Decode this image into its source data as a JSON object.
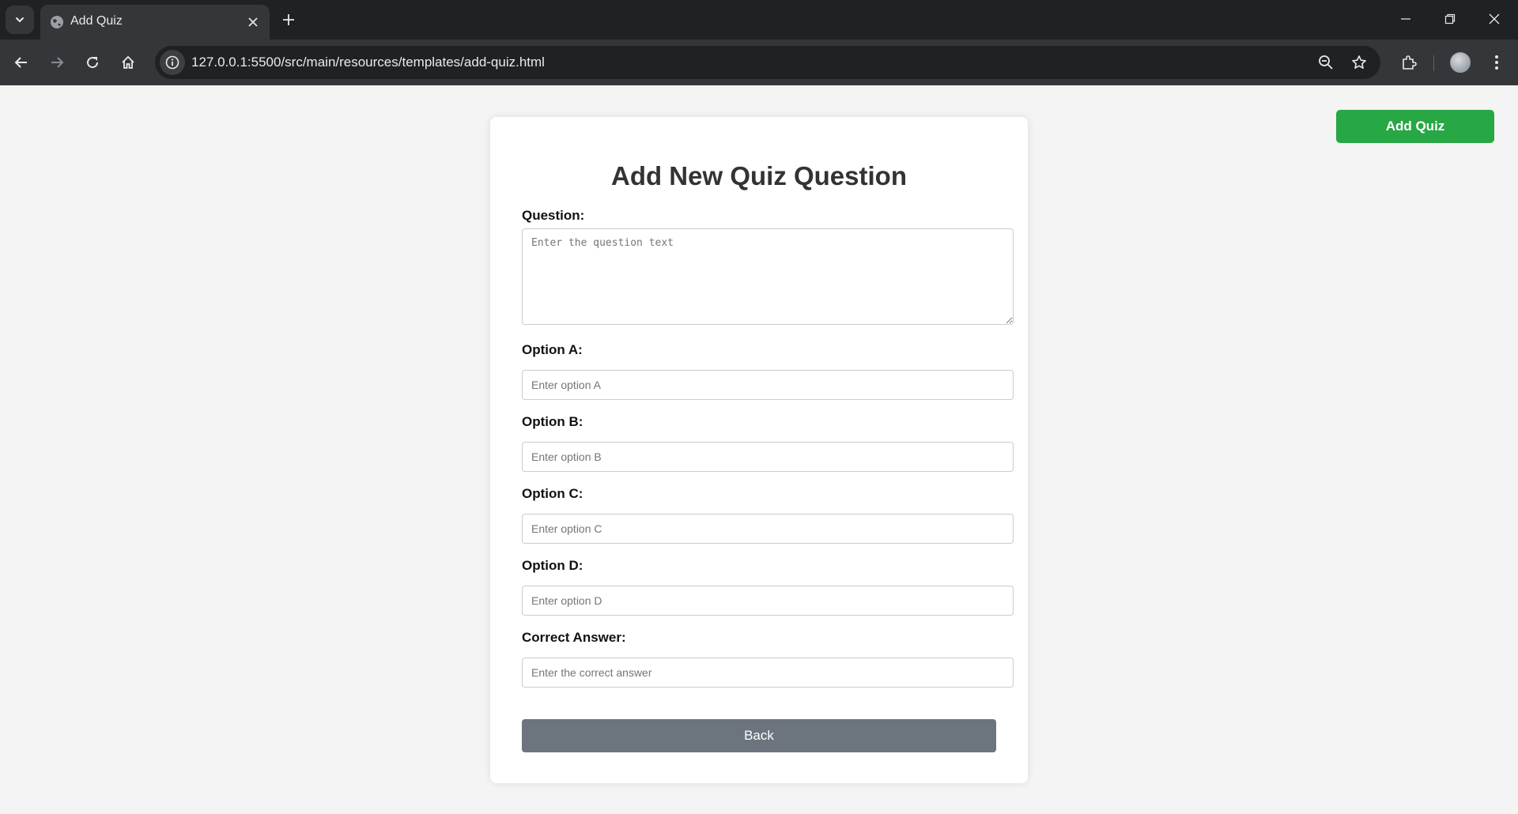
{
  "browser": {
    "tab_title": "Add Quiz",
    "url": "127.0.0.1:5500/src/main/resources/templates/add-quiz.html"
  },
  "header": {
    "add_quiz_label": "Add Quiz"
  },
  "form": {
    "title": "Add New Quiz Question",
    "question": {
      "label": "Question:",
      "placeholder": "Enter the question text",
      "value": ""
    },
    "option_a": {
      "label": "Option A:",
      "placeholder": "Enter option A",
      "value": ""
    },
    "option_b": {
      "label": "Option B:",
      "placeholder": "Enter option B",
      "value": ""
    },
    "option_c": {
      "label": "Option C:",
      "placeholder": "Enter option C",
      "value": ""
    },
    "option_d": {
      "label": "Option D:",
      "placeholder": "Enter option D",
      "value": ""
    },
    "correct_answer": {
      "label": "Correct Answer:",
      "placeholder": "Enter the correct answer",
      "value": ""
    },
    "back_label": "Back"
  },
  "colors": {
    "add_quiz_button": "#28a745",
    "back_button": "#6c757d",
    "page_background": "#f4f4f4",
    "card_background": "#ffffff"
  }
}
